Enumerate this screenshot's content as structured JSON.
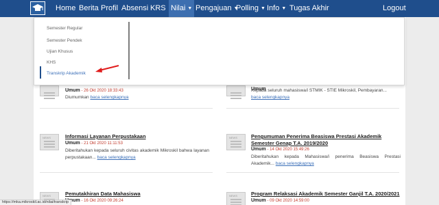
{
  "navbar": {
    "logo_icon": "graduation-cap-icon",
    "items": [
      {
        "label": "Home"
      },
      {
        "label": "Berita"
      },
      {
        "label": "Profil"
      },
      {
        "label": "Absensi"
      },
      {
        "label": "KRS",
        "has_caret": true
      },
      {
        "label": "Nilai",
        "has_caret": true,
        "active": true
      },
      {
        "label": "Pengajuan",
        "has_caret": true
      },
      {
        "label": "Polling",
        "has_caret": true
      },
      {
        "label": "Info",
        "has_caret": true
      },
      {
        "label": "Tugas Akhir"
      }
    ],
    "logout_label": "Logout",
    "caret_glyph": "▼",
    "colors": {
      "background": "#1f4e8c",
      "active": "#3d6fb0"
    }
  },
  "dropdown": {
    "items": [
      {
        "label": "Semester Regular"
      },
      {
        "label": "Semester Pendek"
      },
      {
        "label": "Ujian Khusus"
      },
      {
        "label": "KHS"
      },
      {
        "label": "Transkrip Akademik",
        "selected": true
      }
    ],
    "annotation": "red-arrow-pointer"
  },
  "news": [
    {
      "title": "",
      "category": "Umum",
      "date": "- 26 Okt 2020 18:33:43",
      "desc": "Diumumkan",
      "read_more": "baca selengkapnya"
    },
    {
      "title": "",
      "category": "Umum",
      "date": "",
      "desc": "Kepada seluruh mahasiswa/i STMIK - STIE Mikroskil, Pembayaran...",
      "read_more": "baca selengkapnya"
    },
    {
      "title": "Informasi Layanan Perpustakaan",
      "category": "Umum",
      "date": "- 21 Okt 2020 11:11:53",
      "desc": "Diberitahukan kepada seluruh civitas akademik Mikroskil bahwa layanan perpustakaan...",
      "read_more": "baca selengkapnya"
    },
    {
      "title": "Pengumuman Penerima Beasiswa Prestasi Akademik Semester Genap T.A. 2019/2020",
      "category": "Umum",
      "date": "- 14 Okt 2020 15:49:26",
      "desc": "Diberitahukan kepada Mahasiswa/i penerima Beasiswa Prestasi Akademik...",
      "read_more": "baca selengkapnya"
    },
    {
      "title": "Pemutakhiran Data Mahasiswa",
      "category": "Umum",
      "date": "- 16 Okt 2020 09:26:24",
      "desc": "",
      "read_more": ""
    },
    {
      "title": "Program Relaksasi Akademik Semester Ganjil T.A. 2020/2021",
      "category": "Umum",
      "date": "- 09 Okt 2020 14:59:00",
      "desc": "",
      "read_more": ""
    }
  ],
  "thumb_label": "NEWS",
  "status_url": "https://mka.mikroskil.ac.id/nilai/transkrip"
}
